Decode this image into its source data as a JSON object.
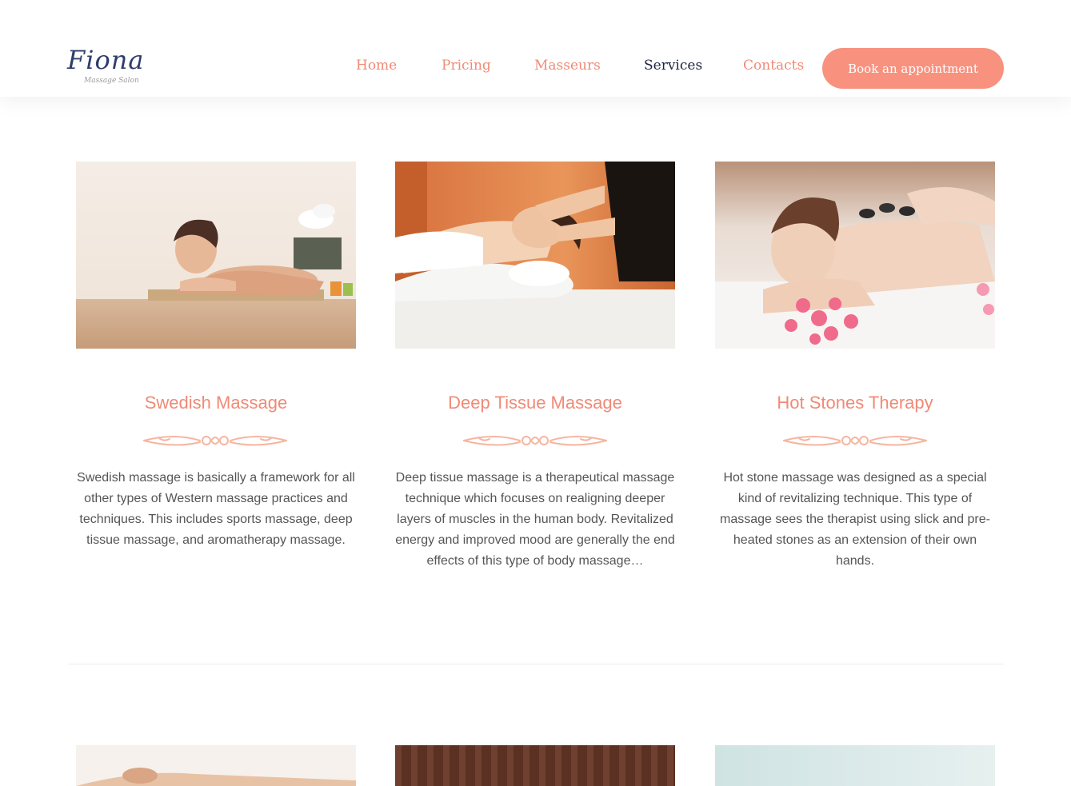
{
  "brand": {
    "logo_text": "Fiona",
    "logo_subtitle": "Massage Salon"
  },
  "nav": {
    "items": [
      {
        "label": "Home"
      },
      {
        "label": "Pricing"
      },
      {
        "label": "Masseurs"
      },
      {
        "label": "Services"
      },
      {
        "label": "Contacts"
      }
    ],
    "active": "Services",
    "cta_label": "Book an appointment"
  },
  "colors": {
    "accent": "#f8927f",
    "title": "#f08a76",
    "nav_active": "#1d2340",
    "text": "#555555"
  },
  "services": [
    {
      "title": "Swedish Massage",
      "description": "Swedish massage is basically a framework for all other types of Western massage practices and techniques. This includes sports massage, deep tissue massage, and aromatherapy massage."
    },
    {
      "title": "Deep Tissue Massage",
      "description": "Deep tissue massage is a therapeutical massage technique which focuses on realigning deeper layers of muscles in the human body. Revitalized energy and improved mood are generally the end effects of this type of body massage…"
    },
    {
      "title": "Hot Stones Therapy",
      "description": "Hot stone massage was designed as a special kind of revitalizing technique. This type of massage sees the therapist using slick and pre-heated stones as an extension of their own hands."
    }
  ],
  "icons": {
    "ornament": "flourish-divider-icon"
  }
}
